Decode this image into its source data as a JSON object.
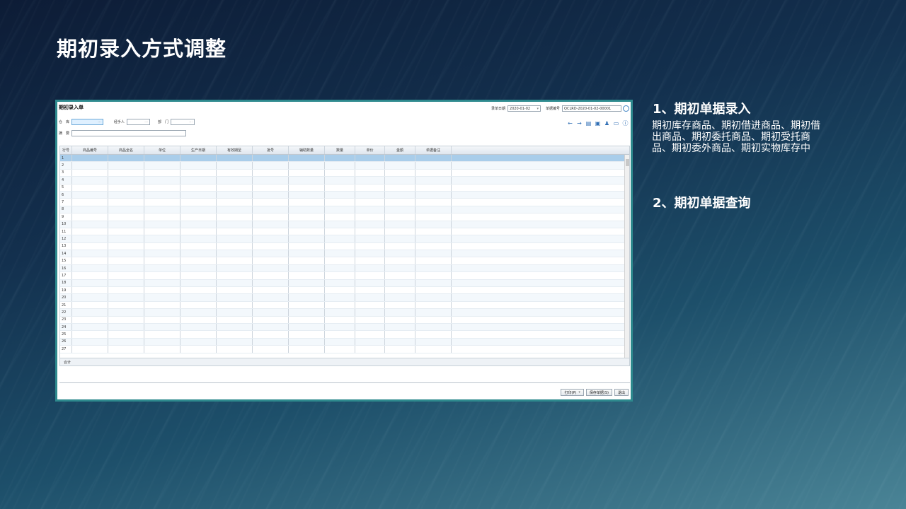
{
  "slide": {
    "title": "期初录入方式调整",
    "points": [
      {
        "title": "1、期初单据录入",
        "desc": "期初库存商品、期初借进商品、期初借出商品、期初委托商品、期初受托商品、期初委外商品、期初实物库存中"
      },
      {
        "title": "2、期初单据查询"
      }
    ]
  },
  "app": {
    "title": "期初录入单",
    "fields": {
      "warehouse_label": "仓　库",
      "handler_label": "经手人",
      "dept_label": "部　门",
      "summary_label": "摘　要",
      "date_label": "录单日期",
      "date_value": "2020-01-02",
      "docno_label": "单据编号",
      "docno_value": "QCLRD-2020-01-02-00001"
    },
    "columns": [
      "行号",
      "商品编号",
      "商品全名",
      "单位",
      "生产日期",
      "有效期至",
      "批号",
      "辅助数量",
      "数量",
      "单价",
      "金额",
      "单据备注"
    ],
    "row_numbers": [
      "1",
      "2",
      "3",
      "4",
      "5",
      "6",
      "7",
      "8",
      "9",
      "10",
      "11",
      "12",
      "13",
      "14",
      "15",
      "16",
      "17",
      "18",
      "19",
      "20",
      "21",
      "22",
      "23",
      "24",
      "25",
      "26",
      "27"
    ],
    "total_label": "合计",
    "buttons": {
      "print": "打印(P)",
      "save": "保存单据(S)",
      "exit": "退出"
    }
  }
}
